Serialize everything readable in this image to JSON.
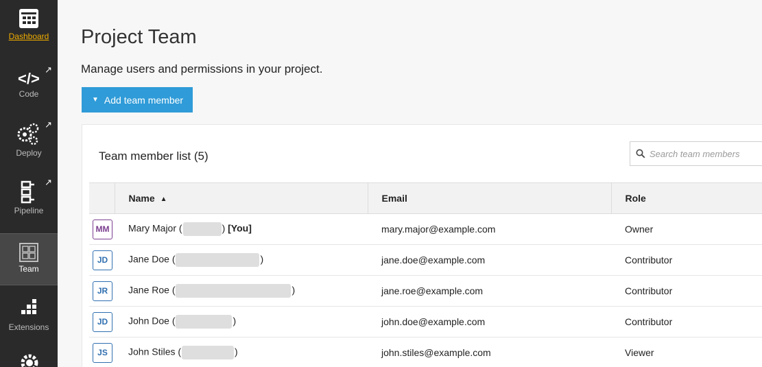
{
  "sidebar": {
    "items": [
      {
        "label": "Dashboard",
        "icon": "dashboard-grid-icon"
      },
      {
        "label": "Code",
        "icon": "code-icon"
      },
      {
        "label": "Deploy",
        "icon": "gears-icon"
      },
      {
        "label": "Pipeline",
        "icon": "pipeline-icon"
      },
      {
        "label": "Team",
        "icon": "team-grid-icon"
      },
      {
        "label": "Extensions",
        "icon": "extensions-icon"
      }
    ],
    "selected": "Team"
  },
  "page": {
    "title": "Project Team",
    "subtitle": "Manage users and permissions in your project."
  },
  "toolbar": {
    "add_member_label": "Add team member"
  },
  "team_list": {
    "title": "Team member list (5)",
    "search_placeholder": "Search team members",
    "columns": {
      "name": "Name",
      "email": "Email",
      "role": "Role"
    },
    "sort": {
      "column": "Name",
      "direction": "ascending"
    },
    "rows": [
      {
        "initials": "MM",
        "name": "Mary Major (",
        "name_end": ")",
        "you_tag": "[You]",
        "email": "mary.major@example.com",
        "role": "Owner"
      },
      {
        "initials": "JD",
        "name": "Jane Doe (",
        "name_end": ")",
        "you_tag": "",
        "email": "jane.doe@example.com",
        "role": "Contributor"
      },
      {
        "initials": "JR",
        "name": "Jane Roe (",
        "name_end": ")",
        "you_tag": "",
        "email": "jane.roe@example.com",
        "role": "Contributor"
      },
      {
        "initials": "JD",
        "name": "John Doe (",
        "name_end": ")",
        "you_tag": "",
        "email": "john.doe@example.com",
        "role": "Contributor"
      },
      {
        "initials": "JS",
        "name": "John Stiles (",
        "name_end": ")",
        "you_tag": "",
        "email": "john.stiles@example.com",
        "role": "Viewer"
      }
    ]
  },
  "colors": {
    "sidebar_bg": "#2a2a2a",
    "accent_button": "#2f9bd8",
    "avatar_default": "#2f6fb0",
    "avatar_owner": "#7a3d8f",
    "dashboard_link": "#f0ad00"
  }
}
